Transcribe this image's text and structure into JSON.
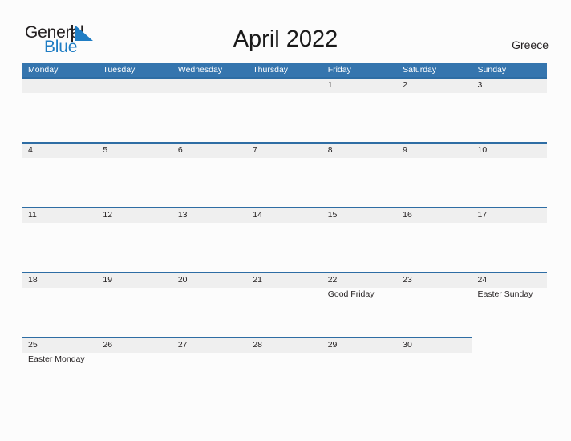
{
  "brand": {
    "word_one": "General",
    "word_two": "Blue",
    "mark_icon": "triangle-logo-icon",
    "color_dark": "#231f20",
    "color_blue": "#1f7dc4"
  },
  "header": {
    "title": "April 2022",
    "country": "Greece"
  },
  "theme": {
    "header_blue": "#3575ae",
    "rule_blue": "#2e6da4",
    "band_gray": "#efefef",
    "page_background": "#fcfcfc",
    "text": "#231f20"
  },
  "calendar": {
    "month": "April",
    "year": "2022",
    "weekday_headers": [
      "Monday",
      "Tuesday",
      "Wednesday",
      "Thursday",
      "Friday",
      "Saturday",
      "Sunday"
    ],
    "weeks": [
      {
        "band_columns": 7,
        "days": [
          {
            "number": "",
            "event": ""
          },
          {
            "number": "",
            "event": ""
          },
          {
            "number": "",
            "event": ""
          },
          {
            "number": "",
            "event": ""
          },
          {
            "number": "1",
            "event": ""
          },
          {
            "number": "2",
            "event": ""
          },
          {
            "number": "3",
            "event": ""
          }
        ]
      },
      {
        "band_columns": 7,
        "days": [
          {
            "number": "4",
            "event": ""
          },
          {
            "number": "5",
            "event": ""
          },
          {
            "number": "6",
            "event": ""
          },
          {
            "number": "7",
            "event": ""
          },
          {
            "number": "8",
            "event": ""
          },
          {
            "number": "9",
            "event": ""
          },
          {
            "number": "10",
            "event": ""
          }
        ]
      },
      {
        "band_columns": 7,
        "days": [
          {
            "number": "11",
            "event": ""
          },
          {
            "number": "12",
            "event": ""
          },
          {
            "number": "13",
            "event": ""
          },
          {
            "number": "14",
            "event": ""
          },
          {
            "number": "15",
            "event": ""
          },
          {
            "number": "16",
            "event": ""
          },
          {
            "number": "17",
            "event": ""
          }
        ]
      },
      {
        "band_columns": 7,
        "days": [
          {
            "number": "18",
            "event": ""
          },
          {
            "number": "19",
            "event": ""
          },
          {
            "number": "20",
            "event": ""
          },
          {
            "number": "21",
            "event": ""
          },
          {
            "number": "22",
            "event": "Good Friday"
          },
          {
            "number": "23",
            "event": ""
          },
          {
            "number": "24",
            "event": "Easter Sunday"
          }
        ]
      },
      {
        "band_columns": 6,
        "days": [
          {
            "number": "25",
            "event": "Easter Monday"
          },
          {
            "number": "26",
            "event": ""
          },
          {
            "number": "27",
            "event": ""
          },
          {
            "number": "28",
            "event": ""
          },
          {
            "number": "29",
            "event": ""
          },
          {
            "number": "30",
            "event": ""
          },
          {
            "number": "",
            "event": ""
          }
        ]
      }
    ]
  }
}
